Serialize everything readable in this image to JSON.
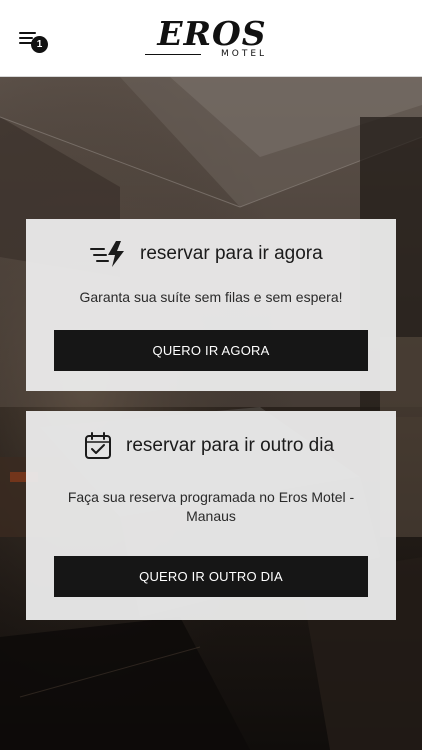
{
  "header": {
    "menu_badge": "1",
    "logo_main": "EROS",
    "logo_sub": "MOTEL"
  },
  "cards": [
    {
      "title": "reservar para ir agora",
      "icon": "fast-lightning-icon",
      "text": "Garanta sua suíte sem filas e sem espera!",
      "button": "QUERO IR AGORA"
    },
    {
      "title": "reservar para ir outro dia",
      "icon": "calendar-check-icon",
      "text": "Faça sua reserva programada no Eros Motel - Manaus",
      "button": "QUERO IR OUTRO DIA"
    }
  ],
  "colors": {
    "header_bg": "#ffffff",
    "card_bg": "#ececec",
    "button_bg": "#161616",
    "button_text": "#ffffff"
  }
}
